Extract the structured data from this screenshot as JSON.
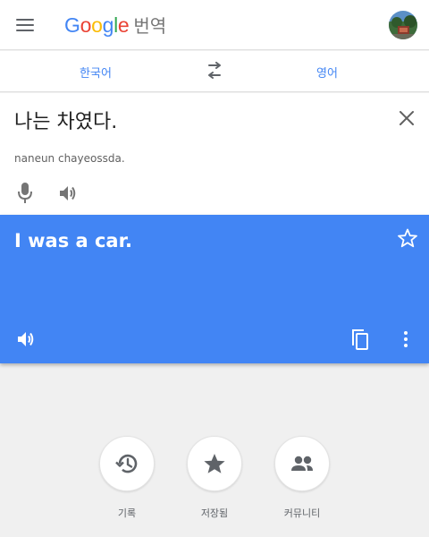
{
  "header": {
    "logo_letters": [
      "G",
      "o",
      "o",
      "g",
      "l",
      "e"
    ],
    "app_name": "번역",
    "menu_icon": "hamburger-menu-icon",
    "avatar_icon": "user-avatar"
  },
  "languages": {
    "source": "한국어",
    "target": "영어",
    "swap_icon": "swap-arrows-icon"
  },
  "source": {
    "text": "나는 차였다.",
    "romanization": "naneun chayeossda.",
    "clear_icon": "close-icon",
    "mic_icon": "microphone-icon",
    "speaker_icon": "speaker-icon"
  },
  "result": {
    "text": "I was a car.",
    "star_icon": "star-outline-icon",
    "speaker_icon": "speaker-icon",
    "copy_icon": "copy-icon",
    "more_icon": "more-vertical-icon",
    "background": "#4285f4"
  },
  "shortcuts": [
    {
      "label": "기록",
      "icon": "history-icon"
    },
    {
      "label": "저장됨",
      "icon": "star-icon"
    },
    {
      "label": "커뮤니티",
      "icon": "people-icon"
    }
  ],
  "colors": {
    "accent": "#4285f4",
    "icon_grey": "#757575",
    "page_bg": "#f0f0f0"
  }
}
